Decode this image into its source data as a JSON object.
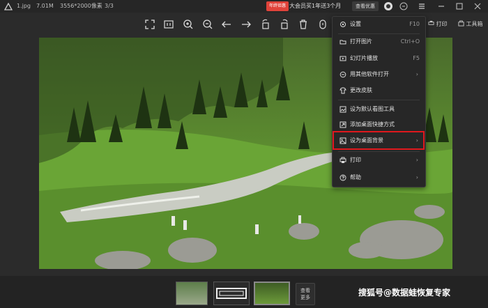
{
  "topbar": {
    "filename": "1.jpg",
    "filesize": "7.01M",
    "resolution": "3556*2000像素",
    "page_index": "3/3",
    "promo_tag": "年终钜惠",
    "promo_text": "大会员买1年送3个月",
    "promo_button": "查看优惠"
  },
  "toolbar": {
    "print_label": "打印",
    "toolbox_label": "工具箱"
  },
  "menu": {
    "items": [
      {
        "label": "设置",
        "shortcut": "F10",
        "icon": "gear-icon"
      },
      {
        "label": "打开图片",
        "shortcut": "Ctrl+O",
        "icon": "folder-icon"
      },
      {
        "label": "幻灯片播放",
        "shortcut": "F5",
        "icon": "slideshow-icon"
      },
      {
        "label": "用其他软件打开",
        "arrow": "›",
        "icon": "open-with-icon"
      },
      {
        "label": "更改皮肤",
        "icon": "skin-icon"
      },
      {
        "label": "设为默认看图工具",
        "icon": "default-app-icon"
      },
      {
        "label": "添加桌面快捷方式",
        "icon": "shortcut-icon"
      },
      {
        "label": "设为桌面背景",
        "arrow": "›",
        "icon": "wallpaper-icon"
      },
      {
        "label": "打印",
        "arrow": "›",
        "icon": "printer-icon"
      },
      {
        "label": "帮助",
        "arrow": "›",
        "icon": "help-icon"
      }
    ]
  },
  "bottom": {
    "see_more": "查看更多",
    "watermark": "搜狐号@数据蛙恢复专家"
  },
  "colors": {
    "highlight": "#e0181d",
    "promo": "#e0433a",
    "menu_bg": "#272727"
  }
}
